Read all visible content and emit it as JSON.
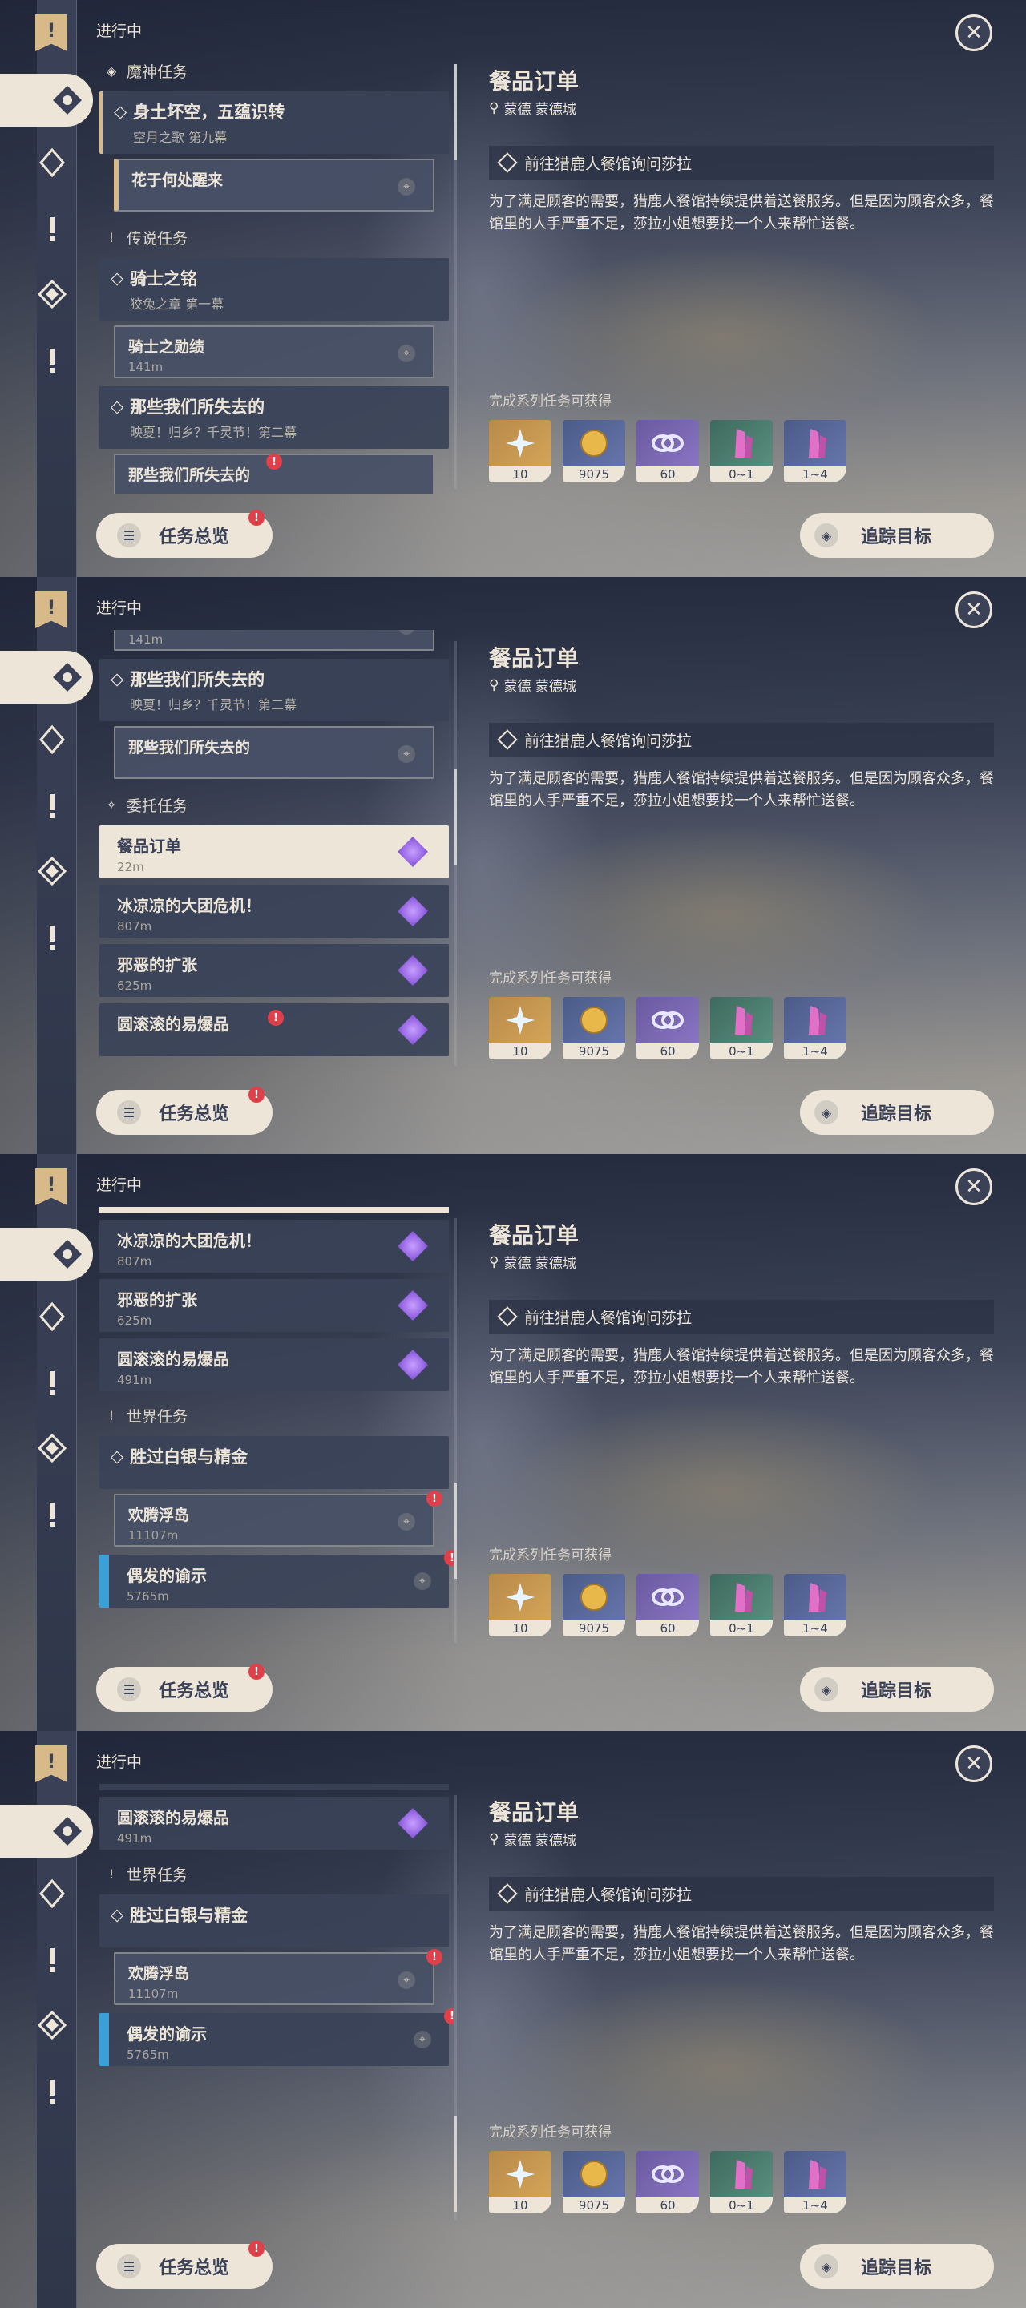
{
  "status_label": "进行中",
  "close_glyph": "✕",
  "detail": {
    "title": "餐品订单",
    "location": "蒙德 蒙德城",
    "objective": "前往猎鹿人餐馆询问莎拉",
    "description": "为了满足顾客的需要，猎鹿人餐馆持续提供着送餐服务。但是因为顾客众多，餐馆里的人手严重不足，莎拉小姐想要找一个人来帮忙送餐。",
    "rewards_label": "完成系列任务可获得",
    "rewards": [
      {
        "name": "primogem",
        "count": "10",
        "color": "#c99550"
      },
      {
        "name": "mora",
        "count": "9075",
        "color": "#5a6a98"
      },
      {
        "name": "adventure-exp",
        "count": "60",
        "color": "#5a6a98"
      },
      {
        "name": "crystal-green",
        "count": "0~1",
        "color": "#4a7a6c"
      },
      {
        "name": "crystal-purple",
        "count": "1~4",
        "color": "#5a6a98"
      }
    ]
  },
  "buttons": {
    "overview": "任务总览",
    "track": "追踪目标"
  },
  "quests": {
    "cat_archon": "魔神任务",
    "cat_legend": "传说任务",
    "cat_commission": "委托任务",
    "cat_world": "世界任务",
    "archon_title": "身土坏空，五蕴识转",
    "archon_sub": "空月之歌 第九幕",
    "archon_step": "花于何处醒来",
    "legend1_title": "骑士之铭",
    "legend1_sub": "狡兔之章 第一幕",
    "legend1_step": "骑士之勋绩",
    "legend1_dist": "141m",
    "legend2_title": "那些我们所失去的",
    "legend2_sub": "映夏！归乡？千灵节！第二幕",
    "legend2_step": "那些我们所失去的",
    "c1": "餐品订单",
    "c1d": "22m",
    "c2": "冰凉凉的大团危机！",
    "c2d": "807m",
    "c3": "邪恶的扩张",
    "c3d": "625m",
    "c4": "圆滚滚的易爆品",
    "c4d": "491m",
    "world_title": "胜过白银与精金",
    "world_step": "欢腾浮岛",
    "world_step_d": "11107m",
    "w2": "偶发的谕示",
    "w2d": "5765m"
  }
}
